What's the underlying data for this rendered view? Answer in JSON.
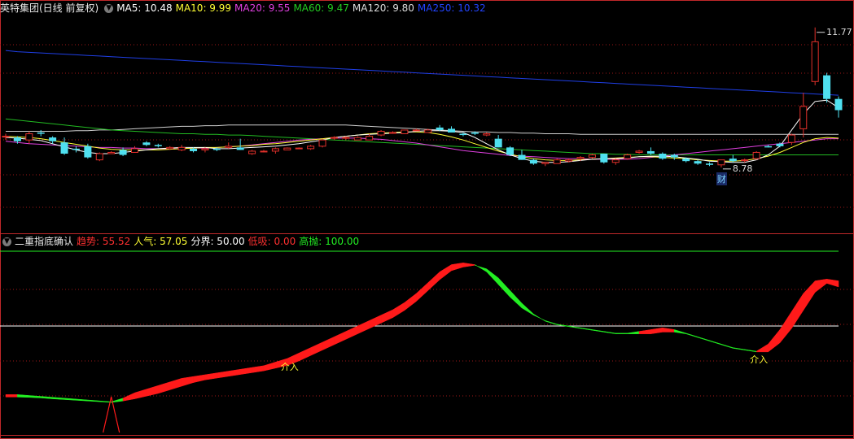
{
  "colors": {
    "bg": "#000000",
    "up": "#e0302a",
    "down": "#4fe0f0",
    "border": "#c0282a",
    "grid": "#a01818",
    "ma5": "#ffffff",
    "ma10": "#ffff33",
    "ma20": "#e040e0",
    "ma60": "#22bb22",
    "ma120": "#cfcfcf",
    "ma250": "#1f3fe6",
    "fast": "#ff1a1a",
    "slow": "#22ee22",
    "baseline": "#ffffff"
  },
  "price_panel": {
    "title": "英特集团(日线 前复权)",
    "chevron_icon": "chevron-down-icon",
    "indicators": [
      {
        "label": "MA5: 10.48",
        "color": "#ffffff"
      },
      {
        "label": "MA10: 9.99",
        "color": "#ffff33"
      },
      {
        "label": "MA20: 9.55",
        "color": "#e040e0"
      },
      {
        "label": "MA60: 9.47",
        "color": "#22cc22"
      },
      {
        "label": "MA120: 9.80",
        "color": "#dddddd"
      },
      {
        "label": "MA250: 10.32",
        "color": "#2244ff"
      }
    ],
    "high_marker": "11.77",
    "low_marker": "8.78",
    "finance_badge": "财"
  },
  "indicator_panel": {
    "title": "二重指底确认",
    "chevron_icon": "chevron-down-icon",
    "values": [
      {
        "label": "趋势: 55.52",
        "color": "#ff3030"
      },
      {
        "label": "人气: 57.05",
        "color": "#ffff33"
      },
      {
        "label": "分界: 50.00",
        "color": "#ffffff"
      },
      {
        "label": "低吸: 0.00",
        "color": "#ff3030"
      },
      {
        "label": "高抛: 100.00",
        "color": "#22ee22"
      }
    ],
    "signal_labels": [
      "介入",
      "介入"
    ]
  },
  "chart_data": {
    "type": "candlestick",
    "candles": [
      [
        10.02,
        10.06,
        9.96,
        10.02
      ],
      [
        10.0,
        10.02,
        9.9,
        9.94
      ],
      [
        9.96,
        10.1,
        9.9,
        10.06
      ],
      [
        10.08,
        10.12,
        10.02,
        10.06
      ],
      [
        10.0,
        10.02,
        9.9,
        9.94
      ],
      [
        9.92,
        10.0,
        9.72,
        9.74
      ],
      [
        9.82,
        9.86,
        9.76,
        9.8
      ],
      [
        9.86,
        9.9,
        9.66,
        9.68
      ],
      [
        9.64,
        9.76,
        9.62,
        9.74
      ],
      [
        9.74,
        9.78,
        9.74,
        9.76
      ],
      [
        9.8,
        9.84,
        9.7,
        9.72
      ],
      [
        9.76,
        9.86,
        9.76,
        9.82
      ],
      [
        9.92,
        9.94,
        9.86,
        9.88
      ],
      [
        9.88,
        9.9,
        9.84,
        9.86
      ],
      [
        9.82,
        9.86,
        9.8,
        9.84
      ],
      [
        9.8,
        9.88,
        9.78,
        9.84
      ],
      [
        9.82,
        9.84,
        9.76,
        9.78
      ],
      [
        9.8,
        9.84,
        9.76,
        9.82
      ],
      [
        9.82,
        9.84,
        9.78,
        9.8
      ],
      [
        9.84,
        9.92,
        9.82,
        9.86
      ],
      [
        9.84,
        9.98,
        9.8,
        9.8
      ],
      [
        9.74,
        9.8,
        9.72,
        9.78
      ],
      [
        9.78,
        9.8,
        9.76,
        9.78
      ],
      [
        9.78,
        9.84,
        9.74,
        9.82
      ],
      [
        9.8,
        9.84,
        9.8,
        9.83
      ],
      [
        9.82,
        9.84,
        9.82,
        9.83
      ],
      [
        9.82,
        9.88,
        9.8,
        9.86
      ],
      [
        9.86,
        9.98,
        9.84,
        9.96
      ],
      [
        10.0,
        10.02,
        9.96,
        10.0
      ],
      [
        10.0,
        10.02,
        9.96,
        10.0
      ],
      [
        9.96,
        10.02,
        9.96,
        10.0
      ],
      [
        9.96,
        10.06,
        9.96,
        10.02
      ],
      [
        10.04,
        10.12,
        10.02,
        10.1
      ],
      [
        10.08,
        10.1,
        10.06,
        10.08
      ],
      [
        10.06,
        10.12,
        10.06,
        10.12
      ],
      [
        10.12,
        10.14,
        10.1,
        10.12
      ],
      [
        10.08,
        10.14,
        10.08,
        10.12
      ],
      [
        10.16,
        10.2,
        10.1,
        10.12
      ],
      [
        10.14,
        10.18,
        10.08,
        10.08
      ],
      [
        10.06,
        10.08,
        10.02,
        10.04
      ],
      [
        10.08,
        10.1,
        10.04,
        10.06
      ],
      [
        10.04,
        10.08,
        10.02,
        10.06
      ],
      [
        9.98,
        10.04,
        9.84,
        9.84
      ],
      [
        9.84,
        9.86,
        9.7,
        9.72
      ],
      [
        9.72,
        9.8,
        9.64,
        9.64
      ],
      [
        9.64,
        9.66,
        9.56,
        9.58
      ],
      [
        9.58,
        9.6,
        9.54,
        9.6
      ],
      [
        9.58,
        9.66,
        9.58,
        9.64
      ],
      [
        9.62,
        9.66,
        9.6,
        9.64
      ],
      [
        9.66,
        9.7,
        9.62,
        9.68
      ],
      [
        9.68,
        9.74,
        9.66,
        9.72
      ],
      [
        9.74,
        9.74,
        9.58,
        9.6
      ],
      [
        9.6,
        9.66,
        9.56,
        9.64
      ],
      [
        9.66,
        9.74,
        9.64,
        9.72
      ],
      [
        9.76,
        9.8,
        9.74,
        9.78
      ],
      [
        9.78,
        9.84,
        9.72,
        9.74
      ],
      [
        9.74,
        9.76,
        9.64,
        9.66
      ],
      [
        9.72,
        9.74,
        9.64,
        9.68
      ],
      [
        9.66,
        9.68,
        9.6,
        9.62
      ],
      [
        9.62,
        9.64,
        9.56,
        9.58
      ],
      [
        9.58,
        9.6,
        9.54,
        9.56
      ],
      [
        9.56,
        9.64,
        9.52,
        9.64
      ],
      [
        9.66,
        9.72,
        9.6,
        9.62
      ],
      [
        9.64,
        9.66,
        9.6,
        9.64
      ],
      [
        9.66,
        9.78,
        9.64,
        9.76
      ],
      [
        9.86,
        9.88,
        9.84,
        9.84
      ],
      [
        9.9,
        9.92,
        9.84,
        9.86
      ],
      [
        9.92,
        10.06,
        9.88,
        10.04
      ],
      [
        10.14,
        10.72,
        10.0,
        10.5
      ],
      [
        10.9,
        11.77,
        10.84,
        11.54
      ],
      [
        11.0,
        11.04,
        10.56,
        10.62
      ],
      [
        10.62,
        10.66,
        10.32,
        10.44
      ]
    ],
    "ma": {
      "ma5": [
        10.0,
        9.99,
        9.97,
        9.95,
        9.9,
        9.85,
        9.8,
        9.76,
        9.74,
        9.74,
        9.76,
        9.78,
        9.8,
        9.82,
        9.83,
        9.84,
        9.84,
        9.84,
        9.82,
        9.82,
        9.83,
        9.84,
        9.85,
        9.86,
        9.88,
        9.9,
        9.93,
        9.96,
        10.0,
        10.02,
        10.04,
        10.05,
        10.06,
        10.07,
        10.08,
        10.1,
        10.11,
        10.11,
        10.1,
        10.08,
        10.0,
        9.9,
        9.8,
        9.72,
        9.66,
        9.62,
        9.6,
        9.6,
        9.61,
        9.63,
        9.65,
        9.66,
        9.66,
        9.67,
        9.69,
        9.7,
        9.7,
        9.69,
        9.67,
        9.65,
        9.62,
        9.61,
        9.6,
        9.6,
        9.64,
        9.72,
        9.86,
        10.12,
        10.38,
        10.58,
        10.6,
        10.48
      ],
      "ma10": [
        10.02,
        10.01,
        10.0,
        9.98,
        9.95,
        9.92,
        9.89,
        9.86,
        9.83,
        9.81,
        9.8,
        9.8,
        9.8,
        9.8,
        9.81,
        9.82,
        9.83,
        9.84,
        9.84,
        9.85,
        9.86,
        9.87,
        9.89,
        9.9,
        9.92,
        9.94,
        9.96,
        9.98,
        10.0,
        10.02,
        10.04,
        10.06,
        10.07,
        10.08,
        10.09,
        10.09,
        10.08,
        10.05,
        10.01,
        9.96,
        9.9,
        9.84,
        9.78,
        9.73,
        9.69,
        9.66,
        9.64,
        9.63,
        9.63,
        9.64,
        9.65,
        9.66,
        9.67,
        9.68,
        9.69,
        9.69,
        9.68,
        9.67,
        9.66,
        9.64,
        9.63,
        9.62,
        9.62,
        9.63,
        9.66,
        9.7,
        9.76,
        9.84,
        9.92,
        9.98,
        10.0,
        9.99
      ],
      "ma20": [
        9.94,
        9.92,
        9.9,
        9.89,
        9.88,
        9.87,
        9.86,
        9.85,
        9.84,
        9.84,
        9.83,
        9.83,
        9.82,
        9.82,
        9.82,
        9.82,
        9.83,
        9.83,
        9.84,
        9.85,
        9.86,
        9.88,
        9.9,
        9.92,
        9.94,
        9.96,
        9.97,
        9.98,
        9.99,
        9.99,
        9.99,
        9.98,
        9.97,
        9.95,
        9.93,
        9.91,
        9.88,
        9.85,
        9.82,
        9.79,
        9.77,
        9.75,
        9.73,
        9.71,
        9.7,
        9.69,
        9.68,
        9.67,
        9.66,
        9.66,
        9.65,
        9.65,
        9.65,
        9.65,
        9.66,
        9.68,
        9.7,
        9.72,
        9.74,
        9.76,
        9.78,
        9.8,
        9.82,
        9.84,
        9.86,
        9.88,
        9.9,
        9.92,
        9.94,
        9.96,
        9.98,
        9.98
      ],
      "ma60": [
        10.3,
        10.28,
        10.26,
        10.24,
        10.22,
        10.2,
        10.18,
        10.16,
        10.14,
        10.12,
        10.11,
        10.1,
        10.09,
        10.08,
        10.07,
        10.06,
        10.06,
        10.05,
        10.05,
        10.04,
        10.04,
        10.03,
        10.02,
        10.01,
        10.0,
        9.99,
        9.98,
        9.97,
        9.96,
        9.95,
        9.94,
        9.93,
        9.92,
        9.91,
        9.9,
        9.89,
        9.88,
        9.87,
        9.86,
        9.85,
        9.84,
        9.83,
        9.82,
        9.81,
        9.8,
        9.79,
        9.78,
        9.77,
        9.76,
        9.75,
        9.74,
        9.74,
        9.73,
        9.73,
        9.72,
        9.72,
        9.72,
        9.72,
        9.72,
        9.72,
        9.72,
        9.72,
        9.72,
        9.72,
        9.72,
        9.72,
        9.72,
        9.72,
        9.72,
        9.72,
        9.72,
        9.72
      ],
      "ma120": [
        10.1,
        10.1,
        10.1,
        10.1,
        10.1,
        10.1,
        10.11,
        10.11,
        10.12,
        10.12,
        10.13,
        10.14,
        10.15,
        10.16,
        10.17,
        10.18,
        10.18,
        10.19,
        10.19,
        10.2,
        10.2,
        10.2,
        10.2,
        10.2,
        10.2,
        10.2,
        10.2,
        10.2,
        10.2,
        10.2,
        10.19,
        10.18,
        10.17,
        10.16,
        10.15,
        10.14,
        10.13,
        10.12,
        10.11,
        10.1,
        10.09,
        10.09,
        10.08,
        10.08,
        10.07,
        10.07,
        10.06,
        10.06,
        10.06,
        10.05,
        10.05,
        10.05,
        10.05,
        10.05,
        10.05,
        10.05,
        10.05,
        10.05,
        10.05,
        10.05,
        10.05,
        10.05,
        10.05,
        10.05,
        10.05,
        10.05,
        10.05,
        10.05,
        10.05,
        10.05,
        10.05,
        10.05
      ],
      "ma250": [
        11.4,
        11.38,
        11.37,
        11.36,
        11.35,
        11.34,
        11.33,
        11.32,
        11.31,
        11.3,
        11.29,
        11.28,
        11.27,
        11.26,
        11.25,
        11.24,
        11.23,
        11.22,
        11.21,
        11.2,
        11.19,
        11.18,
        11.17,
        11.16,
        11.15,
        11.14,
        11.13,
        11.12,
        11.11,
        11.1,
        11.09,
        11.08,
        11.07,
        11.06,
        11.05,
        11.04,
        11.03,
        11.02,
        11.01,
        11.0,
        10.99,
        10.98,
        10.97,
        10.96,
        10.95,
        10.94,
        10.93,
        10.92,
        10.91,
        10.9,
        10.89,
        10.88,
        10.87,
        10.86,
        10.85,
        10.84,
        10.83,
        10.82,
        10.81,
        10.8,
        10.79,
        10.78,
        10.77,
        10.76,
        10.75,
        10.74,
        10.73,
        10.72,
        10.71,
        10.7,
        10.69,
        10.68
      ]
    },
    "indicator": {
      "fast": [
        12,
        12,
        11.5,
        11,
        10.5,
        10,
        9.5,
        9,
        8.5,
        8,
        10,
        13,
        15,
        17,
        19,
        21,
        22,
        23,
        24,
        25,
        26,
        27,
        28,
        30,
        32,
        35,
        38,
        41,
        44,
        47,
        50,
        53,
        56,
        59,
        63,
        68,
        74,
        80,
        84,
        85,
        84,
        80,
        73,
        66,
        60,
        56,
        53,
        51,
        50,
        49,
        48,
        47,
        46,
        46,
        47,
        48,
        49,
        48,
        46,
        44,
        42,
        40,
        38,
        37,
        36,
        40,
        48,
        58,
        68,
        75,
        76,
        75
      ],
      "slow": [
        12,
        12,
        11.8,
        11.5,
        11,
        10.6,
        10.2,
        9.8,
        9.4,
        9,
        9.8,
        11,
        12.5,
        14,
        16,
        18,
        20,
        21.5,
        22.5,
        23.5,
        24.5,
        25.5,
        26.5,
        28,
        29.5,
        32,
        35,
        38,
        41,
        44,
        47,
        50,
        53,
        56,
        60,
        65,
        71,
        77,
        82,
        84,
        85,
        83,
        78,
        71,
        64,
        58,
        54,
        52,
        51,
        50,
        49,
        48,
        47,
        47,
        47,
        47,
        48,
        48,
        47,
        45,
        43,
        41,
        39,
        38,
        37,
        37,
        42,
        50,
        60,
        70,
        75,
        73
      ],
      "low_signal_index": 9,
      "entry_signal_indices": [
        24,
        64
      ],
      "baseline": 50,
      "upper": 100
    }
  }
}
